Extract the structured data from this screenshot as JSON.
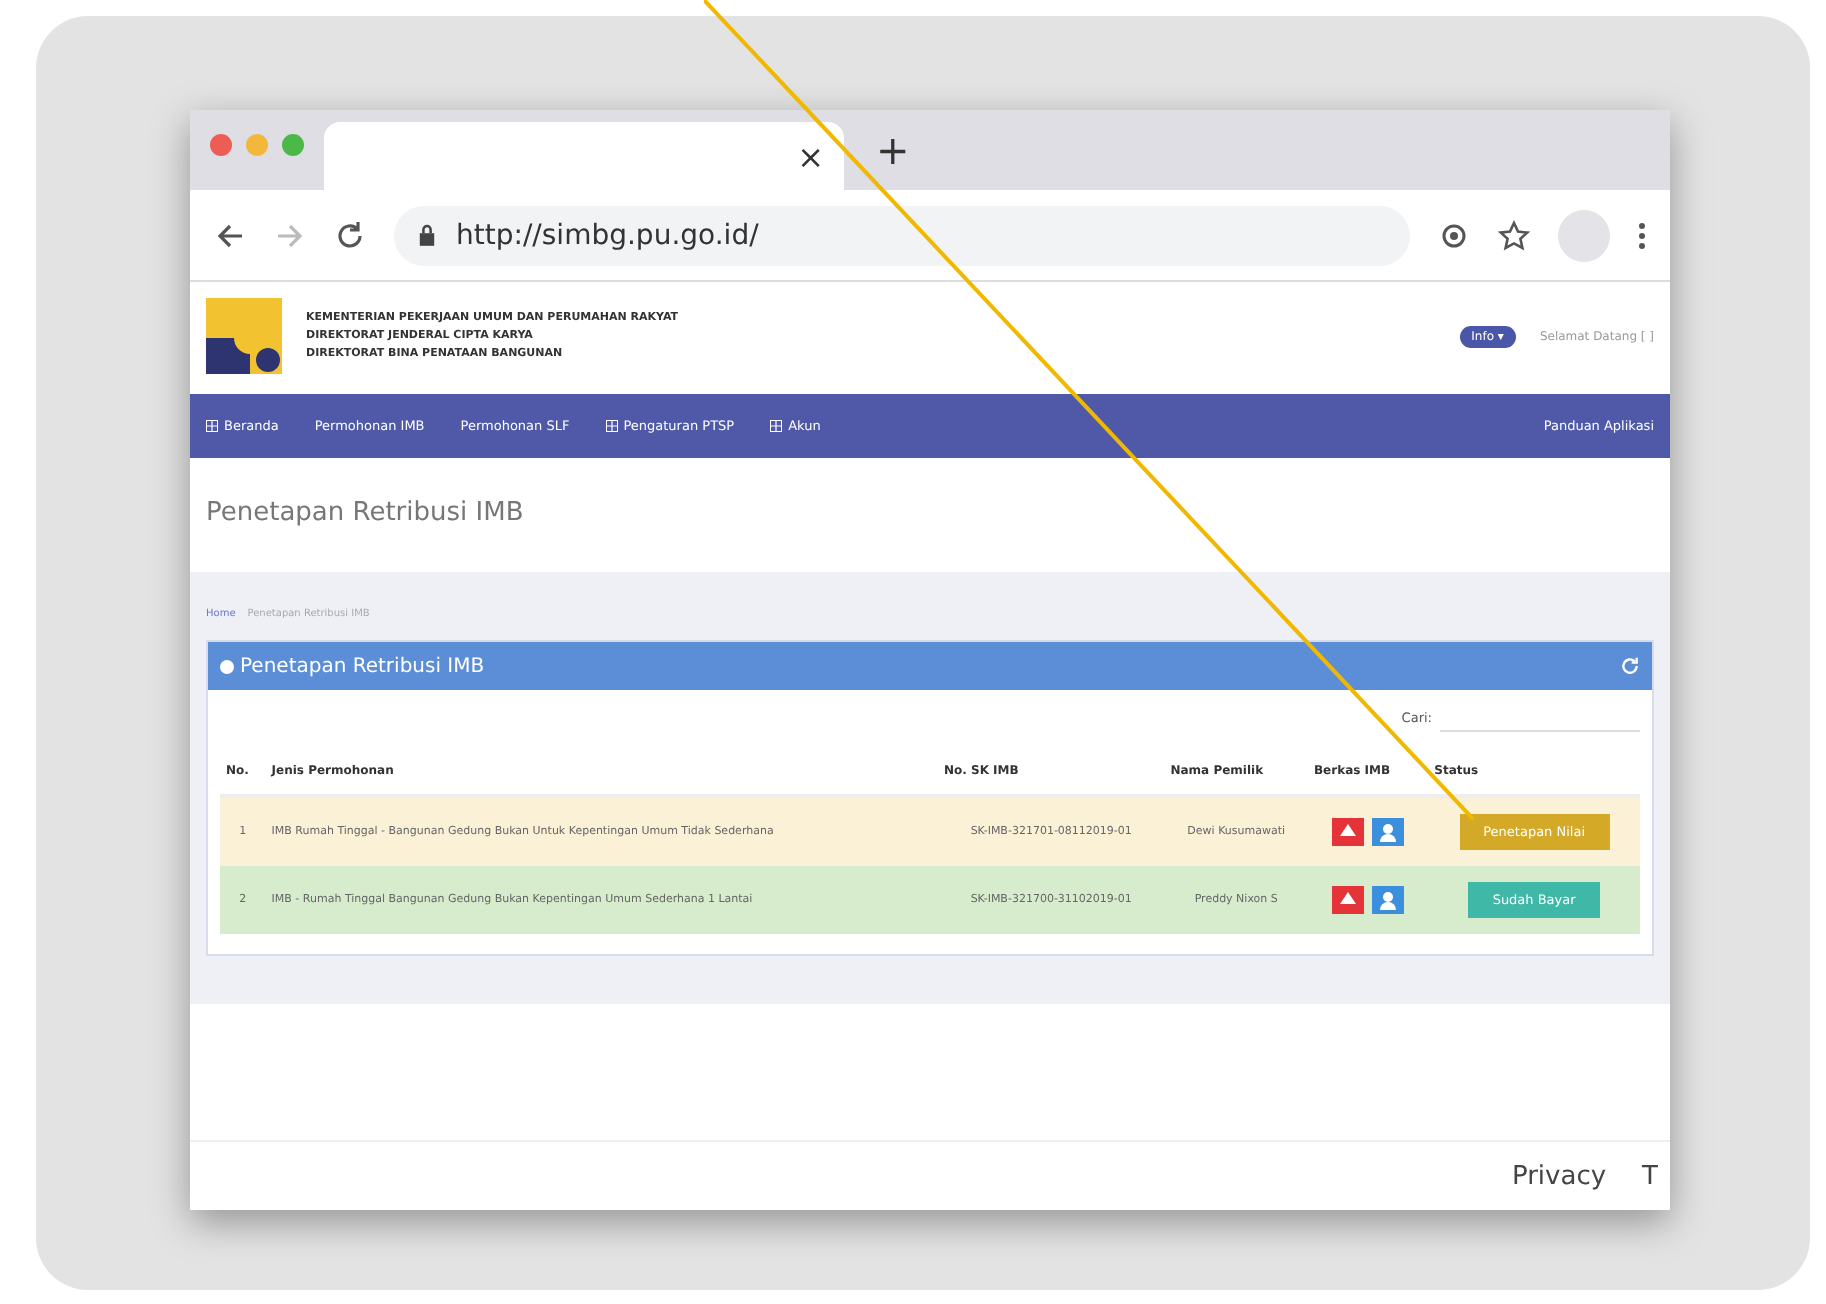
{
  "browser": {
    "tab_close": "×",
    "new_tab": "+",
    "url": "http://simbg.pu.go.id/"
  },
  "header": {
    "org_lines": [
      "KEMENTERIAN PEKERJAAN UMUM DAN PERUMAHAN RAKYAT",
      "DIREKTORAT JENDERAL CIPTA KARYA",
      "DIREKTORAT BINA PENATAAN BANGUNAN"
    ],
    "user_badge": "Info ▾",
    "user_text": "Selamat Datang [ ]"
  },
  "nav": {
    "items": [
      {
        "label": "Beranda",
        "icon": true
      },
      {
        "label": "Permohonan IMB",
        "icon": false
      },
      {
        "label": "Permohonan SLF",
        "icon": false
      },
      {
        "label": "Pengaturan PTSP",
        "icon": true
      },
      {
        "label": "Akun",
        "icon": true
      }
    ],
    "right": "Panduan Aplikasi"
  },
  "page_title": "Penetapan Retribusi IMB",
  "breadcrumb": [
    "Home",
    "Penetapan Retribusi IMB"
  ],
  "panel": {
    "title": "Penetapan Retribusi IMB",
    "search_label": "Cari:",
    "columns": [
      "No.",
      "Jenis Permohonan",
      "No. SK IMB",
      "Nama Pemilik",
      "Berkas IMB",
      "Status"
    ],
    "rows": [
      {
        "no": "1",
        "jenis": "IMB Rumah Tinggal - Bangunan Gedung Bukan Untuk Kepentingan Umum Tidak Sederhana",
        "sk": "SK-IMB-321701-08112019-01",
        "pemilik": "Dewi Kusumawati",
        "status": "Penetapan Nilai",
        "kind": "pending"
      },
      {
        "no": "2",
        "jenis": "IMB - Rumah Tinggal Bangunan Gedung Bukan Kepentingan Umum Sederhana 1 Lantai",
        "sk": "SK-IMB-321700-31102019-01",
        "pemilik": "Preddy Nixon S",
        "status": "Sudah Bayar",
        "kind": "done"
      }
    ]
  },
  "footer": {
    "links": [
      "Privacy",
      "T"
    ]
  }
}
